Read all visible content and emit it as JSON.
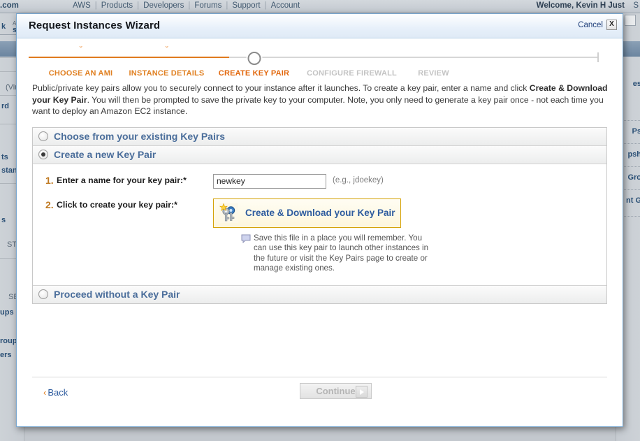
{
  "topnav": {
    "site_suffix": ".com",
    "links": [
      "AWS",
      "Products",
      "Developers",
      "Forums",
      "Support",
      "Account"
    ],
    "welcome": "Welcome, Kevin H Just",
    "far_right": "S"
  },
  "background_page": {
    "left_fragments": [
      "k",
      "A",
      "s",
      "(Vir",
      "rd",
      "ts",
      "stan",
      "s",
      "STO",
      "SEC",
      "ups",
      "roup",
      "ers"
    ],
    "right_fragments": [
      "es",
      "Ps",
      "psh",
      "Gro",
      "nt G"
    ]
  },
  "dialog": {
    "title": "Request Instances Wizard",
    "cancel_label": "Cancel",
    "close_label": "X"
  },
  "steps": [
    {
      "label": "CHOOSE AN AMI",
      "state": "done",
      "caret": "ˇ"
    },
    {
      "label": "INSTANCE DETAILS",
      "state": "done",
      "caret": "ˇ"
    },
    {
      "label": "CREATE KEY PAIR",
      "state": "current",
      "caret": ""
    },
    {
      "label": "CONFIGURE FIREWALL",
      "state": "todo",
      "caret": ""
    },
    {
      "label": "REVIEW",
      "state": "todo",
      "caret": ""
    }
  ],
  "description": {
    "part1": "Public/private key pairs allow you to securely connect to your instance after it launches. To create a key pair, enter a name and click ",
    "bold": "Create & Download your Key Pair",
    "part2": ". You will then be prompted to save the private key to your computer. Note, you only need to generate a key pair once - not each time you want to deploy an Amazon EC2 instance."
  },
  "options": {
    "existing": {
      "label": "Choose from your existing Key Pairs",
      "selected": false
    },
    "create_new": {
      "label": "Create a new Key Pair",
      "selected": true
    },
    "proceed_without": {
      "label": "Proceed without a Key Pair",
      "selected": false
    }
  },
  "create_new_panel": {
    "step1": {
      "number": "1.",
      "label": "Enter a name for your key pair:*",
      "value": "newkey",
      "placeholder": "",
      "hint": "(e.g., jdoekey)"
    },
    "step2": {
      "number": "2.",
      "label": "Click to create your key pair:*",
      "button_label": "Create & Download your Key Pair"
    },
    "note": "Save this file in a place you will remember. You can use this key pair to launch other instances in the future or visit the Key Pairs page to create or manage existing ones."
  },
  "footer": {
    "back_label": "Back",
    "back_chevron": "‹",
    "continue_label": "Continue",
    "continue_enabled": false
  },
  "colors": {
    "accent_orange": "#e2670c",
    "step_done": "#e08022",
    "step_todo": "#c3c3c3",
    "link_blue": "#2d5b9e",
    "option_label_blue": "#4b6e9b",
    "button_border_gold": "#d5a30a",
    "dialog_border": "#7aa8d0"
  }
}
